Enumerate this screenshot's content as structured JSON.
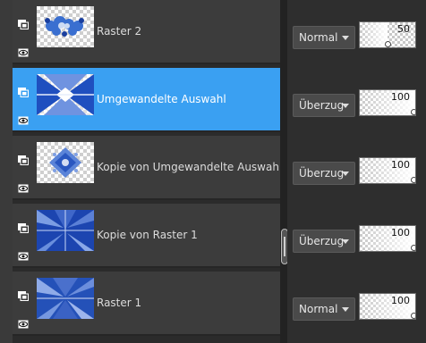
{
  "layers": [
    {
      "name": "Raster 2",
      "blend_mode": "Normal",
      "opacity_label": "50",
      "opacity": 50,
      "selected": false,
      "thumbnail": "snowflake-cluster"
    },
    {
      "name": "Umgewandelte Auswahl",
      "blend_mode": "Überzug",
      "opacity_label": "100",
      "opacity": 100,
      "selected": true,
      "thumbnail": "blue-triangles"
    },
    {
      "name": "Kopie von Umgewandelte Auswahl",
      "blend_mode": "Überzug",
      "opacity_label": "100",
      "opacity": 100,
      "selected": false,
      "thumbnail": "blue-diamond"
    },
    {
      "name": "Kopie von Raster 1",
      "blend_mode": "Überzug",
      "opacity_label": "100",
      "opacity": 100,
      "selected": false,
      "thumbnail": "blue-rays"
    },
    {
      "name": "Raster 1",
      "blend_mode": "Normal",
      "opacity_label": "100",
      "opacity": 100,
      "selected": false,
      "thumbnail": "blue-rays"
    }
  ],
  "icons": {
    "layer_type": "layer-stack-icon",
    "visibility": "eye-icon",
    "dropdown": "chevron-down-icon"
  },
  "colors": {
    "selected_row": "#3aa0f2",
    "row_background": "#3c3c3c",
    "panel_background": "#2b2b2b",
    "thumb_blue": "#1f4fbf"
  }
}
